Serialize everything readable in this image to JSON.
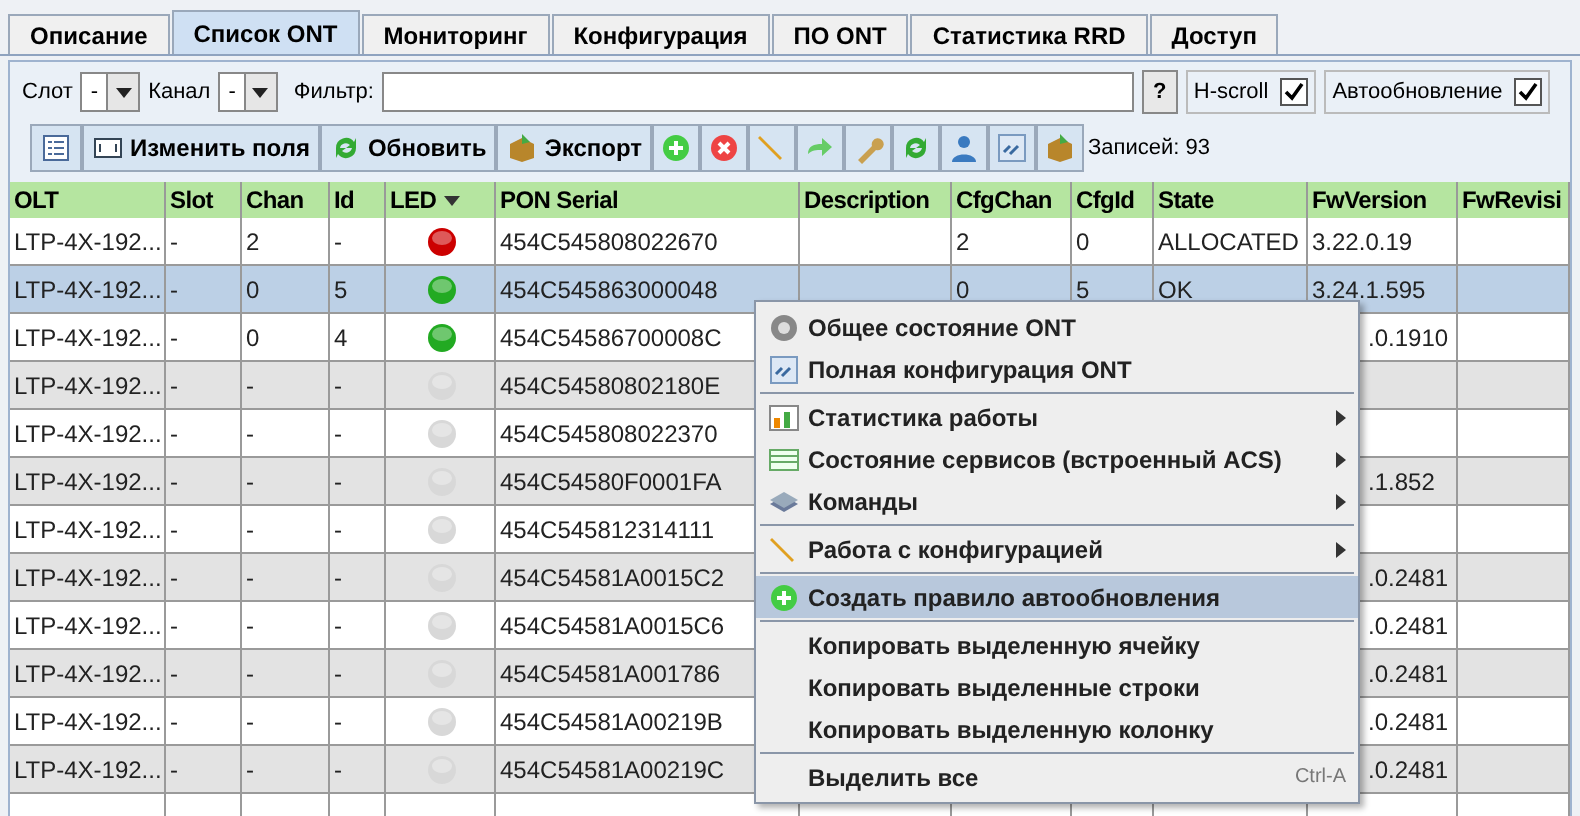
{
  "tabs": [
    {
      "label": "Описание",
      "selected": false
    },
    {
      "label": "Список ONT",
      "selected": true
    },
    {
      "label": "Мониторинг",
      "selected": false
    },
    {
      "label": "Конфигурация",
      "selected": false
    },
    {
      "label": "ПО ONT",
      "selected": false
    },
    {
      "label": "Статистика RRD",
      "selected": false
    },
    {
      "label": "Доступ",
      "selected": false
    }
  ],
  "filters": {
    "slot_label": "Слот",
    "slot_value": "-",
    "channel_label": "Канал",
    "channel_value": "-",
    "filter_label": "Фильтр:",
    "help_button": "?",
    "hscroll": {
      "label": "H-scroll",
      "checked": true
    },
    "autoupdate": {
      "label": "Автообновление",
      "checked": true
    }
  },
  "toolbar": {
    "buttons": [
      "Изменить поля",
      "Обновить",
      "Экспорт"
    ],
    "record_count": "Записей: 93"
  },
  "table": {
    "columns": [
      {
        "label": "OLT",
        "sorted": false
      },
      {
        "label": "Slot",
        "sorted": false
      },
      {
        "label": "Chan",
        "sorted": false
      },
      {
        "label": "Id",
        "sorted": false
      },
      {
        "label": "LED",
        "sorted": true
      },
      {
        "label": "PON Serial",
        "sorted": false
      },
      {
        "label": "Description",
        "sorted": false
      },
      {
        "label": "CfgChan",
        "sorted": false
      },
      {
        "label": "CfgId",
        "sorted": false
      },
      {
        "label": "State",
        "sorted": false
      },
      {
        "label": "FwVersion",
        "sorted": false
      },
      {
        "label": "FwRevisi",
        "sorted": false
      }
    ],
    "rows": [
      {
        "selected": false,
        "color": "#cc0000",
        "cells": [
          "LTP-4X-192...",
          "-",
          "2",
          "-",
          "",
          "454C545808022670",
          "",
          "2",
          "0",
          "ALLOCATED",
          "3.22.0.19",
          ""
        ]
      },
      {
        "selected": true,
        "color": "#22aa22",
        "cells": [
          "LTP-4X-192...",
          "-",
          "0",
          "5",
          "",
          "454C545863000048",
          "",
          "0",
          "5",
          "OK",
          "3.24.1.595",
          ""
        ]
      },
      {
        "selected": false,
        "color": "#22aa22",
        "cells": [
          "LTP-4X-192...",
          "-",
          "0",
          "4",
          "",
          "454C54586700008C",
          "",
          "",
          "",
          "",
          ".0.1910",
          ""
        ]
      },
      {
        "selected": false,
        "color": "#d8d8d8",
        "cells": [
          "LTP-4X-192...",
          "-",
          "-",
          "-",
          "",
          "454C54580802180E",
          "",
          "",
          "",
          "",
          "",
          ""
        ]
      },
      {
        "selected": false,
        "color": "#d8d8d8",
        "cells": [
          "LTP-4X-192...",
          "-",
          "-",
          "-",
          "",
          "454C545808022370",
          "",
          "",
          "",
          "",
          "",
          ""
        ]
      },
      {
        "selected": false,
        "color": "#d8d8d8",
        "cells": [
          "LTP-4X-192...",
          "-",
          "-",
          "-",
          "",
          "454C54580F0001FA",
          "",
          "",
          "",
          "",
          ".1.852",
          ""
        ]
      },
      {
        "selected": false,
        "color": "#d8d8d8",
        "cells": [
          "LTP-4X-192...",
          "-",
          "-",
          "-",
          "",
          "454C545812314111",
          "",
          "",
          "",
          "",
          "",
          ""
        ]
      },
      {
        "selected": false,
        "color": "#d8d8d8",
        "cells": [
          "LTP-4X-192...",
          "-",
          "-",
          "-",
          "",
          "454C54581A0015C2",
          "",
          "",
          "",
          "",
          ".0.2481",
          ""
        ]
      },
      {
        "selected": false,
        "color": "#d8d8d8",
        "cells": [
          "LTP-4X-192...",
          "-",
          "-",
          "-",
          "",
          "454C54581A0015C6",
          "",
          "",
          "",
          "",
          ".0.2481",
          ""
        ]
      },
      {
        "selected": false,
        "color": "#d8d8d8",
        "cells": [
          "LTP-4X-192...",
          "-",
          "-",
          "-",
          "",
          "454C54581A001786",
          "",
          "",
          "",
          "",
          ".0.2481",
          ""
        ]
      },
      {
        "selected": false,
        "color": "#d8d8d8",
        "cells": [
          "LTP-4X-192...",
          "-",
          "-",
          "-",
          "",
          "454C54581A00219B",
          "",
          "",
          "",
          "",
          ".0.2481",
          ""
        ]
      },
      {
        "selected": false,
        "color": "#d8d8d8",
        "cells": [
          "LTP-4X-192...",
          "-",
          "-",
          "-",
          "",
          "454C54581A00219C",
          "",
          "",
          "",
          "",
          ".0.2481",
          ""
        ]
      }
    ]
  },
  "context_menu": [
    {
      "kind": "item",
      "label": "Общее состояние ONT",
      "submenu": false,
      "selected": false
    },
    {
      "kind": "item",
      "label": "Полная конфигурация ONT",
      "submenu": false,
      "selected": false
    },
    {
      "kind": "separator"
    },
    {
      "kind": "item",
      "label": "Статистика работы",
      "submenu": true,
      "selected": false
    },
    {
      "kind": "item",
      "label": "Состояние сервисов (встроенный ACS)",
      "submenu": true,
      "selected": false
    },
    {
      "kind": "item",
      "label": "Команды",
      "submenu": true,
      "selected": false
    },
    {
      "kind": "separator"
    },
    {
      "kind": "item",
      "label": "Работа с конфигурацией",
      "submenu": true,
      "selected": false
    },
    {
      "kind": "separator"
    },
    {
      "kind": "item",
      "label": "Создать правило автообновления",
      "submenu": false,
      "selected": true
    },
    {
      "kind": "separator"
    },
    {
      "kind": "item",
      "label": "Копировать выделенную ячейку",
      "submenu": false,
      "selected": false
    },
    {
      "kind": "item",
      "label": "Копировать выделенные строки",
      "submenu": false,
      "selected": false
    },
    {
      "kind": "item",
      "label": "Копировать выделенную колонку",
      "submenu": false,
      "selected": false
    },
    {
      "kind": "separator"
    },
    {
      "kind": "item",
      "label": "Выделить все",
      "submenu": false,
      "selected": false,
      "shortcut": "Ctrl-A"
    }
  ]
}
